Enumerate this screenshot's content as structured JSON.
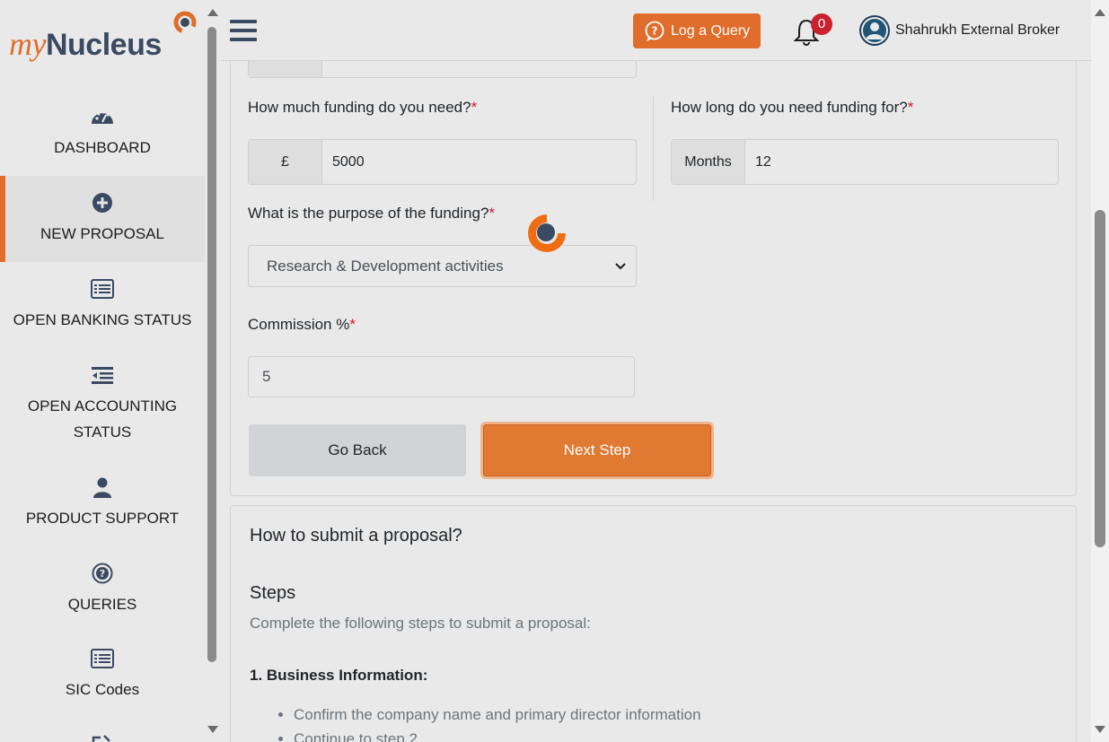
{
  "logo": {
    "part1": "my",
    "part2": "Nucleus"
  },
  "sidebar": {
    "items": [
      {
        "label": "DASHBOARD",
        "icon": "gauge-icon"
      },
      {
        "label": "NEW PROPOSAL",
        "icon": "plus-circle-icon",
        "active": true
      },
      {
        "label": "OPEN BANKING STATUS",
        "icon": "list-icon"
      },
      {
        "label": "OPEN ACCOUNTING",
        "label2": "STATUS",
        "icon": "indent-list-icon"
      },
      {
        "label": "PRODUCT SUPPORT",
        "icon": "user-icon"
      },
      {
        "label": "QUERIES",
        "icon": "question-circle-icon"
      },
      {
        "label": "SIC Codes",
        "icon": "list-icon"
      }
    ]
  },
  "header": {
    "query_button": "Log a Query",
    "notification_count": "0",
    "user_name": "Shahrukh External Broker"
  },
  "form": {
    "funding_amount": {
      "label": "How much funding do you need?",
      "required": "*",
      "prefix": "£",
      "value": "5000"
    },
    "funding_duration": {
      "label": "How long do you need funding for?",
      "required": "*",
      "prefix": "Months",
      "value": "12"
    },
    "purpose": {
      "label": "What is the purpose of the funding?",
      "required": "*",
      "selected": "Research & Development activities"
    },
    "commission": {
      "label": "Commission %",
      "required": "*",
      "value": "5"
    },
    "back_button": "Go Back",
    "next_button": "Next Step"
  },
  "info": {
    "title": "How to submit a proposal?",
    "steps_heading": "Steps",
    "steps_intro": "Complete the following steps to submit a proposal:",
    "step1_title": "1. Business Information:",
    "step1_items": [
      "Confirm the company name and primary director information",
      "Continue to step 2"
    ]
  },
  "colors": {
    "accent": "#e06d2b",
    "brand_dark": "#3b4a63",
    "required": "#d11a2a",
    "badge": "#c9212e"
  }
}
